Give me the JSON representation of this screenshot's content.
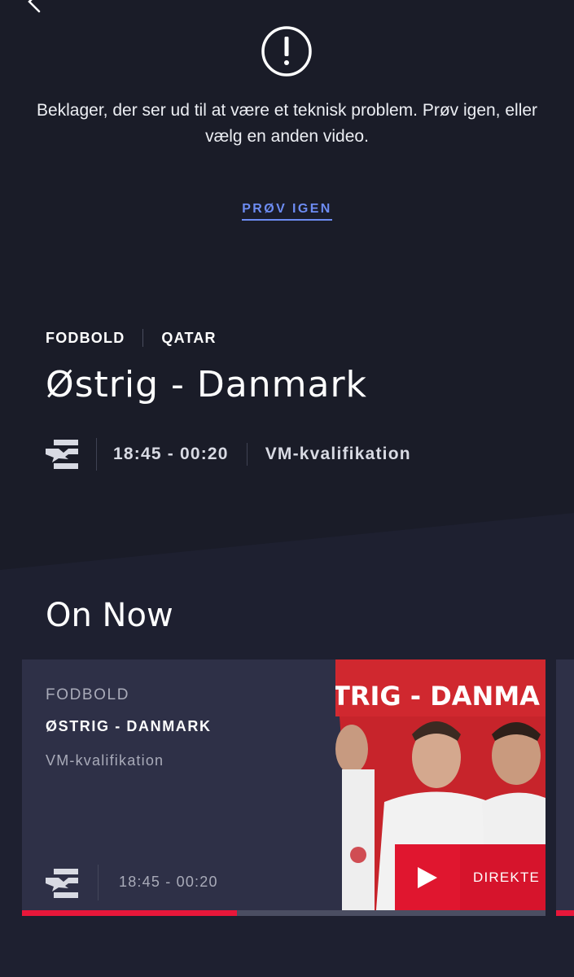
{
  "error": {
    "message": "Beklager, der ser ud til at være et teknisk problem. Prøv igen, eller vælg en anden video.",
    "retry_label": "PRØV IGEN"
  },
  "event": {
    "sport": "FODBOLD",
    "location": "QATAR",
    "title": "Østrig - Danmark",
    "time": "18:45 - 00:20",
    "competition": "VM-kvalifikation"
  },
  "on_now": {
    "heading": "On Now",
    "cards": [
      {
        "sport": "FODBOLD",
        "title": "ØSTRIG - DANMARK",
        "competition": "VM-kvalifikation",
        "time": "18:45 - 00:20",
        "thumbnail_text": "TRIG - DANMA",
        "live_label": "DIREKTE",
        "progress": 0.41
      }
    ]
  },
  "colors": {
    "background": "#1a1c28",
    "card": "#2e3047",
    "accent_link": "#6d8cf2",
    "live_red": "#d6142c"
  }
}
